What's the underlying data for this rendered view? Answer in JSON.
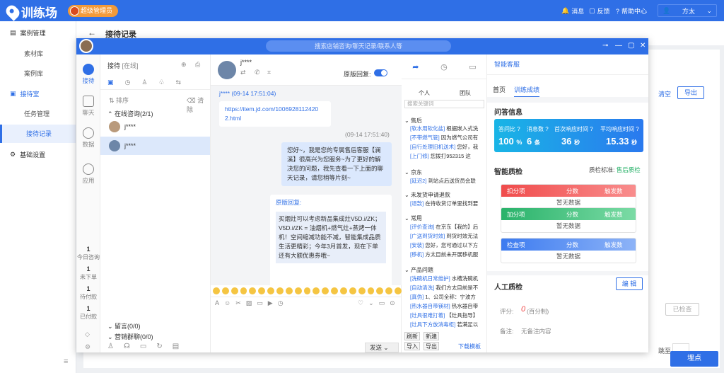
{
  "topbar": {
    "logo_text": "训练场",
    "badge": "超级管理员",
    "nav": {
      "messages": "消息",
      "feedback": "反馈",
      "help": "帮助中心"
    },
    "user": "方太"
  },
  "sidebar": {
    "case_mgmt": "案例管理",
    "material_lib": "素材库",
    "case_lib": "案例库",
    "reception": "接待室",
    "task_mgmt": "任务管理",
    "reception_record": "接待记录",
    "base_settings": "基础设置"
  },
  "page": {
    "title": "接待记录",
    "clear": "清空",
    "export": "导出",
    "goto": "跳至",
    "bury_point": "埋点",
    "bg_button": "已检查"
  },
  "modal": {
    "search_placeholder": "搜索店铺咨询/聊天记录/联系人等",
    "rail": {
      "reception": "接待",
      "chat": "聊天",
      "data": "数据",
      "apps": "应用"
    },
    "stats": [
      {
        "value": "1",
        "label": "今日咨询"
      },
      {
        "value": "1",
        "label": "未下单"
      },
      {
        "value": "1",
        "label": "待付款"
      },
      {
        "value": "1",
        "label": "已付款"
      }
    ]
  },
  "sessions": {
    "title": "接待",
    "status": "[在线]",
    "sort": "排序",
    "clear": "清除",
    "group": "在线咨询(2/1)",
    "items": [
      {
        "name": "j****"
      },
      {
        "name": "j****"
      }
    ],
    "leave_msg": "留言(0/0)",
    "marketing": "营销群聊(0/0)"
  },
  "chat": {
    "customer_name": "j****",
    "original_reply_label": "原版回复:",
    "msg1_meta": "j**** (09-14 17:51:04)",
    "msg1_link": "https://item.jd.com/1006928112420 2.html",
    "msg2_time": "(09-14 17:51:40)",
    "msg2_text": "您好~，我是您的专属售后客服【澜溪】很高兴为您服务~为了更好的解决您的问题，我先查看一下上面的聊天记录，请您稍等片刻~",
    "msg3_label": "原版回复:",
    "msg3_text": "买烟灶可以考虑新品集成灶V5D.i/ZK；V5D.i/ZK = 油烟机+燃气灶+蒸烤一体机！空间缩减功能不减，智能集成品质生活更精彩；今年3月首发，现在下单还有大额优惠券哦~",
    "send": "发送"
  },
  "quick": {
    "tab_personal": "个人",
    "tab_team": "团队",
    "search_placeholder": "搜索关键词",
    "groups": [
      {
        "name": "售后",
        "lines": [
          {
            "tag": "[软水用软化盐]",
            "text": "根据嵌入式洗"
          },
          {
            "tag": "[不带燃气管]",
            "text": "因为燃气公司有"
          },
          {
            "tag": "[自行处理旧机送术]",
            "text": "您好，我"
          },
          {
            "tag": "[上门修]",
            "text": "您拨打952315 这"
          }
        ]
      },
      {
        "name": "京东",
        "lines": [
          {
            "tag": "[延迟2]",
            "text": "到站点后送货员会联"
          }
        ]
      },
      {
        "name": "未发货申请退款",
        "lines": [
          {
            "tag": "[退款]",
            "text": "在待收货订单里找到要"
          }
        ]
      },
      {
        "name": "常用",
        "lines": [
          {
            "tag": "[评价查询]",
            "text": "在京东【我的】后"
          },
          {
            "tag": "[广送到货时效]",
            "text": "到货时效无法"
          },
          {
            "tag": "[安装]",
            "text": "您好，您可通过以下方"
          },
          {
            "tag": "[移机]",
            "text": "方太目前未开展移机服"
          }
        ]
      },
      {
        "name": "产品问题",
        "lines": [
          {
            "tag": "[洗碗机日常维护]",
            "text": "水槽洗碗机"
          },
          {
            "tag": "[自动清洗]",
            "text": "我们方太目前是不"
          },
          {
            "tag": "[真伪]",
            "text": "1、公司全称：宁波方"
          },
          {
            "tag": "[热水器自带镁材]",
            "text": "热水器自带"
          },
          {
            "tag": "[灶具很难打着]",
            "text": "【灶具指导】"
          },
          {
            "tag": "[灶具下方放消毒柜]",
            "text": "若满足以"
          }
        ]
      }
    ],
    "btn_refresh": "刷新",
    "btn_new": "新建",
    "btn_import": "导入",
    "btn_export": "导出",
    "download": "下载模板"
  },
  "right": {
    "tab_smart": "智能客服",
    "tab_home": "首页",
    "tab_train": "训练成绩",
    "qa_title": "问答信息",
    "qa_metrics": [
      {
        "label": "答问比",
        "value": "100",
        "unit": "%"
      },
      {
        "label": "消息数",
        "value": "6",
        "unit": "条"
      },
      {
        "label": "首次响应时间",
        "value": "36",
        "unit": "秒"
      },
      {
        "label": "平均响应时间",
        "value": "15.33",
        "unit": "秒"
      }
    ],
    "inspect_title": "智能质检",
    "inspect_std_label": "质检标准:",
    "inspect_std_value": "售后质检",
    "tables": [
      {
        "title": "扣分项",
        "score": "分数",
        "trigger": "触发数",
        "empty": "暂无数据",
        "color": "#f04b4b"
      },
      {
        "title": "加分项",
        "score": "分数",
        "trigger": "触发数",
        "empty": "暂无数据",
        "color": "#29b26a"
      },
      {
        "title": "检查项",
        "score": "分数",
        "trigger": "触发数",
        "empty": "暂无数据",
        "color": "#3c7bf0"
      }
    ],
    "manual_title": "人工质检",
    "edit": "编 辑",
    "score_label": "评分:",
    "score_value": "0",
    "score_unit": "(百分制)",
    "remark_label": "备注:",
    "remark_value": "无备注内容"
  }
}
